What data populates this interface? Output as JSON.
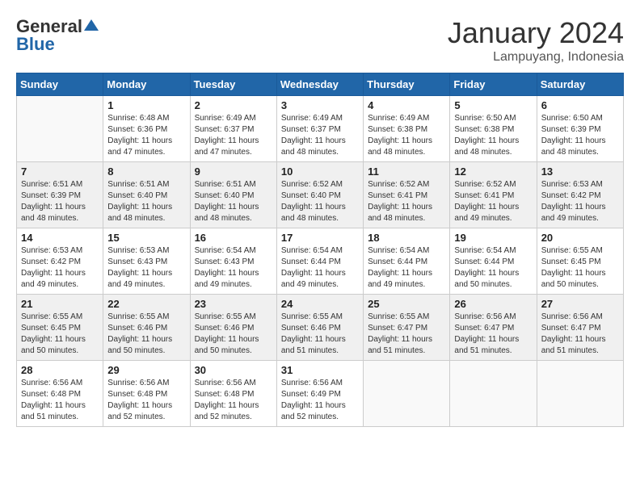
{
  "logo": {
    "general": "General",
    "blue": "Blue"
  },
  "title": "January 2024",
  "location": "Lampuyang, Indonesia",
  "days_of_week": [
    "Sunday",
    "Monday",
    "Tuesday",
    "Wednesday",
    "Thursday",
    "Friday",
    "Saturday"
  ],
  "weeks": [
    [
      {
        "day": "",
        "info": ""
      },
      {
        "day": "1",
        "info": "Sunrise: 6:48 AM\nSunset: 6:36 PM\nDaylight: 11 hours\nand 47 minutes."
      },
      {
        "day": "2",
        "info": "Sunrise: 6:49 AM\nSunset: 6:37 PM\nDaylight: 11 hours\nand 47 minutes."
      },
      {
        "day": "3",
        "info": "Sunrise: 6:49 AM\nSunset: 6:37 PM\nDaylight: 11 hours\nand 48 minutes."
      },
      {
        "day": "4",
        "info": "Sunrise: 6:49 AM\nSunset: 6:38 PM\nDaylight: 11 hours\nand 48 minutes."
      },
      {
        "day": "5",
        "info": "Sunrise: 6:50 AM\nSunset: 6:38 PM\nDaylight: 11 hours\nand 48 minutes."
      },
      {
        "day": "6",
        "info": "Sunrise: 6:50 AM\nSunset: 6:39 PM\nDaylight: 11 hours\nand 48 minutes."
      }
    ],
    [
      {
        "day": "7",
        "info": "Sunrise: 6:51 AM\nSunset: 6:39 PM\nDaylight: 11 hours\nand 48 minutes."
      },
      {
        "day": "8",
        "info": "Sunrise: 6:51 AM\nSunset: 6:40 PM\nDaylight: 11 hours\nand 48 minutes."
      },
      {
        "day": "9",
        "info": "Sunrise: 6:51 AM\nSunset: 6:40 PM\nDaylight: 11 hours\nand 48 minutes."
      },
      {
        "day": "10",
        "info": "Sunrise: 6:52 AM\nSunset: 6:40 PM\nDaylight: 11 hours\nand 48 minutes."
      },
      {
        "day": "11",
        "info": "Sunrise: 6:52 AM\nSunset: 6:41 PM\nDaylight: 11 hours\nand 48 minutes."
      },
      {
        "day": "12",
        "info": "Sunrise: 6:52 AM\nSunset: 6:41 PM\nDaylight: 11 hours\nand 49 minutes."
      },
      {
        "day": "13",
        "info": "Sunrise: 6:53 AM\nSunset: 6:42 PM\nDaylight: 11 hours\nand 49 minutes."
      }
    ],
    [
      {
        "day": "14",
        "info": "Sunrise: 6:53 AM\nSunset: 6:42 PM\nDaylight: 11 hours\nand 49 minutes."
      },
      {
        "day": "15",
        "info": "Sunrise: 6:53 AM\nSunset: 6:43 PM\nDaylight: 11 hours\nand 49 minutes."
      },
      {
        "day": "16",
        "info": "Sunrise: 6:54 AM\nSunset: 6:43 PM\nDaylight: 11 hours\nand 49 minutes."
      },
      {
        "day": "17",
        "info": "Sunrise: 6:54 AM\nSunset: 6:44 PM\nDaylight: 11 hours\nand 49 minutes."
      },
      {
        "day": "18",
        "info": "Sunrise: 6:54 AM\nSunset: 6:44 PM\nDaylight: 11 hours\nand 49 minutes."
      },
      {
        "day": "19",
        "info": "Sunrise: 6:54 AM\nSunset: 6:44 PM\nDaylight: 11 hours\nand 50 minutes."
      },
      {
        "day": "20",
        "info": "Sunrise: 6:55 AM\nSunset: 6:45 PM\nDaylight: 11 hours\nand 50 minutes."
      }
    ],
    [
      {
        "day": "21",
        "info": "Sunrise: 6:55 AM\nSunset: 6:45 PM\nDaylight: 11 hours\nand 50 minutes."
      },
      {
        "day": "22",
        "info": "Sunrise: 6:55 AM\nSunset: 6:46 PM\nDaylight: 11 hours\nand 50 minutes."
      },
      {
        "day": "23",
        "info": "Sunrise: 6:55 AM\nSunset: 6:46 PM\nDaylight: 11 hours\nand 50 minutes."
      },
      {
        "day": "24",
        "info": "Sunrise: 6:55 AM\nSunset: 6:46 PM\nDaylight: 11 hours\nand 51 minutes."
      },
      {
        "day": "25",
        "info": "Sunrise: 6:55 AM\nSunset: 6:47 PM\nDaylight: 11 hours\nand 51 minutes."
      },
      {
        "day": "26",
        "info": "Sunrise: 6:56 AM\nSunset: 6:47 PM\nDaylight: 11 hours\nand 51 minutes."
      },
      {
        "day": "27",
        "info": "Sunrise: 6:56 AM\nSunset: 6:47 PM\nDaylight: 11 hours\nand 51 minutes."
      }
    ],
    [
      {
        "day": "28",
        "info": "Sunrise: 6:56 AM\nSunset: 6:48 PM\nDaylight: 11 hours\nand 51 minutes."
      },
      {
        "day": "29",
        "info": "Sunrise: 6:56 AM\nSunset: 6:48 PM\nDaylight: 11 hours\nand 52 minutes."
      },
      {
        "day": "30",
        "info": "Sunrise: 6:56 AM\nSunset: 6:48 PM\nDaylight: 11 hours\nand 52 minutes."
      },
      {
        "day": "31",
        "info": "Sunrise: 6:56 AM\nSunset: 6:49 PM\nDaylight: 11 hours\nand 52 minutes."
      },
      {
        "day": "",
        "info": ""
      },
      {
        "day": "",
        "info": ""
      },
      {
        "day": "",
        "info": ""
      }
    ]
  ]
}
